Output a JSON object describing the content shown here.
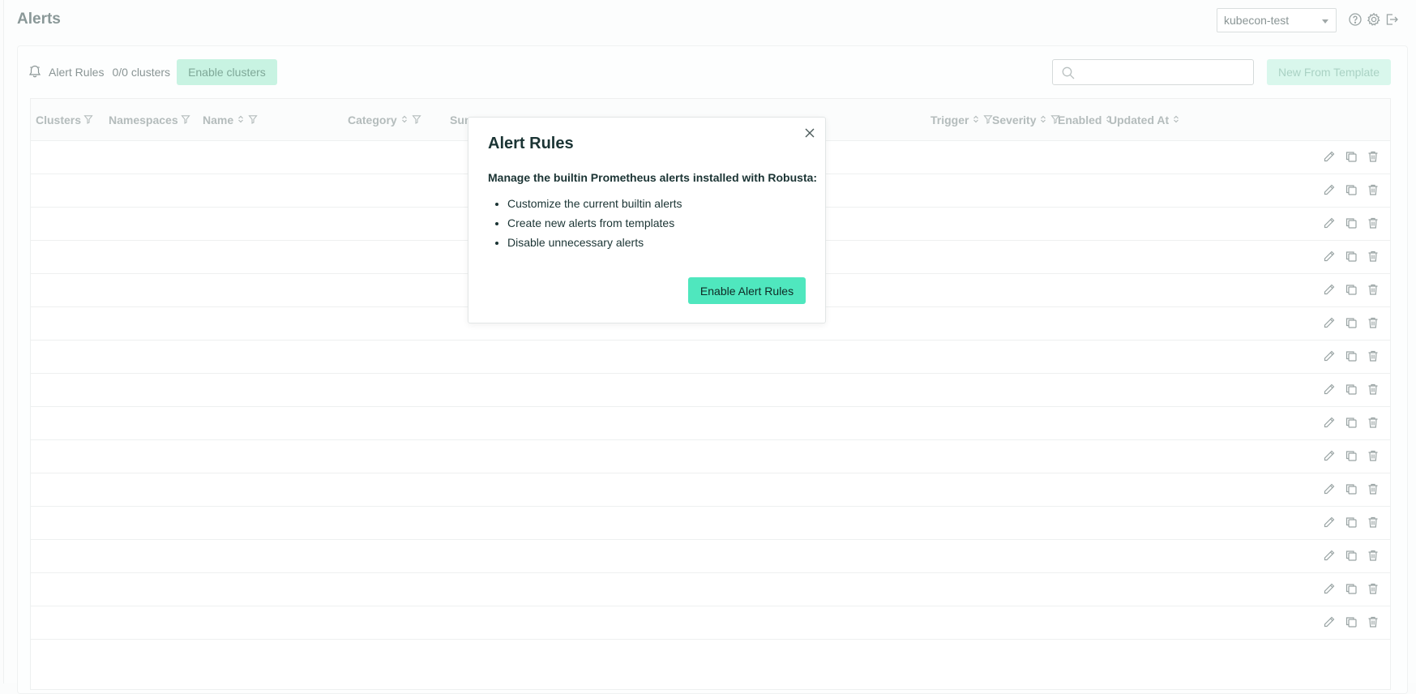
{
  "page": {
    "title": "Alerts"
  },
  "header": {
    "cluster_select": {
      "value": "kubecon-test"
    },
    "icons": [
      "help-icon",
      "gear-icon",
      "logout-icon"
    ]
  },
  "toolbar": {
    "section_label": "Alert Rules",
    "cluster_count": "0/0 clusters",
    "enable_clusters_label": "Enable clusters",
    "search_placeholder": "",
    "new_from_template_label": "New From Template"
  },
  "table": {
    "columns": [
      {
        "label": "Clusters",
        "sort": false,
        "filter": true
      },
      {
        "label": "Namespaces",
        "sort": false,
        "filter": true
      },
      {
        "label": "Name",
        "sort": true,
        "filter": true
      },
      {
        "label": "Category",
        "sort": true,
        "filter": true
      },
      {
        "label": "Summary",
        "sort": false,
        "filter": false
      },
      {
        "label": "Trigger",
        "sort": true,
        "filter": true
      },
      {
        "label": "Severity",
        "sort": true,
        "filter": true
      },
      {
        "label": "Enabled",
        "sort": true,
        "filter": false
      },
      {
        "label": "Updated At",
        "sort": true,
        "filter": false
      }
    ],
    "row_count": 15,
    "row_actions": [
      "edit-icon",
      "copy-icon",
      "delete-icon"
    ]
  },
  "modal": {
    "title": "Alert Rules",
    "lead": "Manage the builtin Prometheus alerts installed with Robusta:",
    "items": [
      "Customize the current builtin alerts",
      "Create new alerts from templates",
      "Disable unnecessary alerts"
    ],
    "primary_label": "Enable Alert Rules"
  },
  "colors": {
    "accent": "#4fe7be",
    "accent_disabled": "#c8f3e2",
    "muted_text": "#8a9595"
  }
}
